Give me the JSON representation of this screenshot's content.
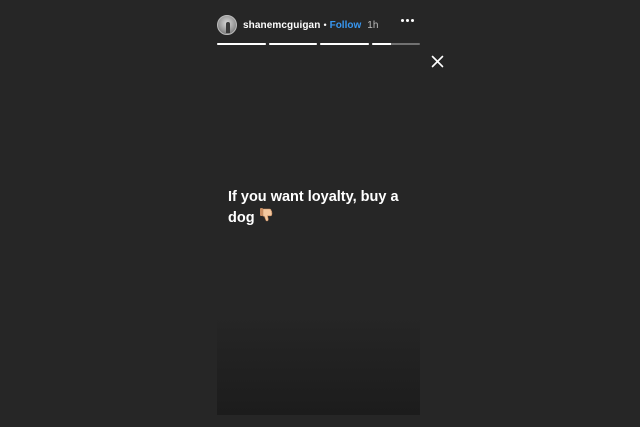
{
  "story": {
    "username": "shanemcguigan",
    "separator": "•",
    "follow_label": "Follow",
    "time": "1h",
    "caption": "If you want loyalty, buy a dog",
    "emoji_icon": "thumbs-down-icon",
    "progress_segments": [
      1,
      1,
      1,
      0.4
    ],
    "avatar_icon": "profile-photo"
  },
  "colors": {
    "background": "#262626",
    "follow": "#3897f0",
    "text": "#ffffff"
  }
}
